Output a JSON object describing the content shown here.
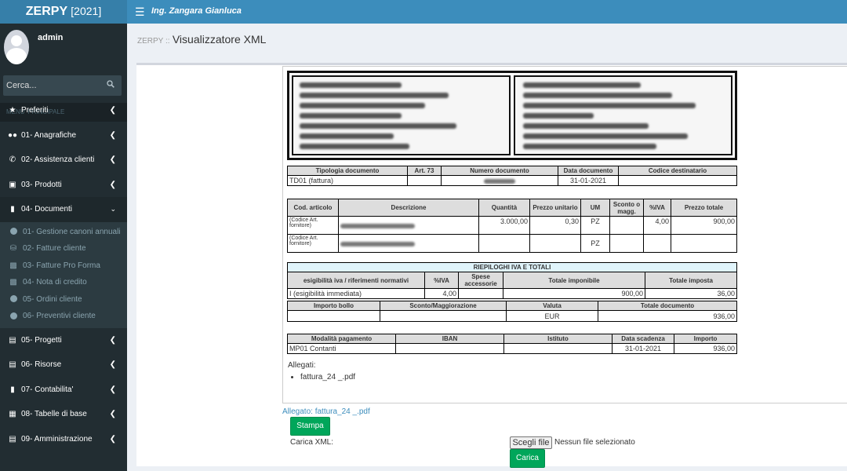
{
  "app": {
    "name": "ZERPY",
    "year": "[2021]",
    "user_header": "Ing. Zangara Gianluca"
  },
  "sidebar": {
    "username": "admin",
    "search_placeholder": "Cerca...",
    "section_header": "MENU' PRINCIPALE",
    "items": [
      {
        "label": "Preferiti",
        "icon": "star-icon"
      },
      {
        "label": "01- Anagrafiche",
        "icon": "users-icon"
      },
      {
        "label": "02- Assistenza clienti",
        "icon": "phone-icon"
      },
      {
        "label": "03- Prodotti",
        "icon": "laptop-icon"
      },
      {
        "label": "04- Documenti",
        "icon": "file-icon"
      }
    ],
    "subitems": [
      {
        "label": "01- Gestione canoni annuali",
        "icon": "circle-icon"
      },
      {
        "label": "02- Fatture cliente",
        "icon": "car-icon"
      },
      {
        "label": "03- Fatture Pro Forma",
        "icon": "basket-icon"
      },
      {
        "label": "04- Nota di credito",
        "icon": "basket-icon"
      },
      {
        "label": "05- Ordini cliente",
        "icon": "circle-icon"
      },
      {
        "label": "06- Preventivi cliente",
        "icon": "circle-icon"
      }
    ],
    "items_after": [
      {
        "label": "05- Progetti",
        "icon": "industry-icon"
      },
      {
        "label": "06- Risorse",
        "icon": "hdd-icon"
      },
      {
        "label": "07- Contabilita'",
        "icon": "file-text-icon"
      },
      {
        "label": "08- Tabelle di base",
        "icon": "table-icon"
      },
      {
        "label": "09- Amministrazione",
        "icon": "hdd-icon"
      }
    ]
  },
  "page": {
    "brand": "ZERPY ::",
    "title": "Visualizzatore XML"
  },
  "doc": {
    "head1": {
      "tipologia": "Tipologia documento",
      "art73": "Art. 73",
      "numero": "Numero documento",
      "data": "Data documento",
      "codice": "Codice destinatario"
    },
    "row1": {
      "tipologia": "TD01 (fattura)",
      "data": "31-01-2021"
    },
    "head2": {
      "cod": "Cod. articolo",
      "descr": "Descrizione",
      "qta": "Quantità",
      "prezzo": "Prezzo unitario",
      "um": "UM",
      "sconto": "Sconto o magg.",
      "iva": "%IVA",
      "totale": "Prezzo totale"
    },
    "line1": {
      "cod": "(Codice Art. fornitore)",
      "qta": "3.000,00",
      "prezzo": "0,30",
      "um": "PZ",
      "iva": "4,00",
      "totale": "900,00"
    },
    "line2": {
      "cod": "(Codice Art. fornitore)",
      "um": "PZ"
    },
    "riep": {
      "title": "RIEPILOGHI IVA E TOTALI",
      "h_esig": "esigibilità iva / riferimenti normativi",
      "h_iva": "%IVA",
      "h_spese": "Spese accessorie",
      "h_impon": "Totale imponibile",
      "h_imposta": "Totale imposta",
      "esig": "I (esigibilità immediata)",
      "iva": "4,00",
      "impon": "900,00",
      "imposta": "36,00",
      "h_bollo": "Importo bollo",
      "h_sconto": "Sconto/Maggiorazione",
      "h_valuta": "Valuta",
      "h_totdoc": "Totale documento",
      "valuta": "EUR",
      "totdoc": "936,00"
    },
    "pag": {
      "h_mod": "Modalità pagamento",
      "h_iban": "IBAN",
      "h_ist": "Istituto",
      "h_scad": "Data scadenza",
      "h_imp": "Importo",
      "mod": "MP01 Contanti",
      "scad": "31-01-2021",
      "imp": "936,00"
    },
    "allegati_label": "Allegati:",
    "allegato_file": "fattura_24 _.pdf"
  },
  "actions": {
    "allegato_link": "Allegato: fattura_24 _.pdf",
    "stampa": "Stampa",
    "carica_label": "Carica XML:",
    "scegli": "Scegli file",
    "nessun": "Nessun file selezionato",
    "carica": "Carica"
  }
}
